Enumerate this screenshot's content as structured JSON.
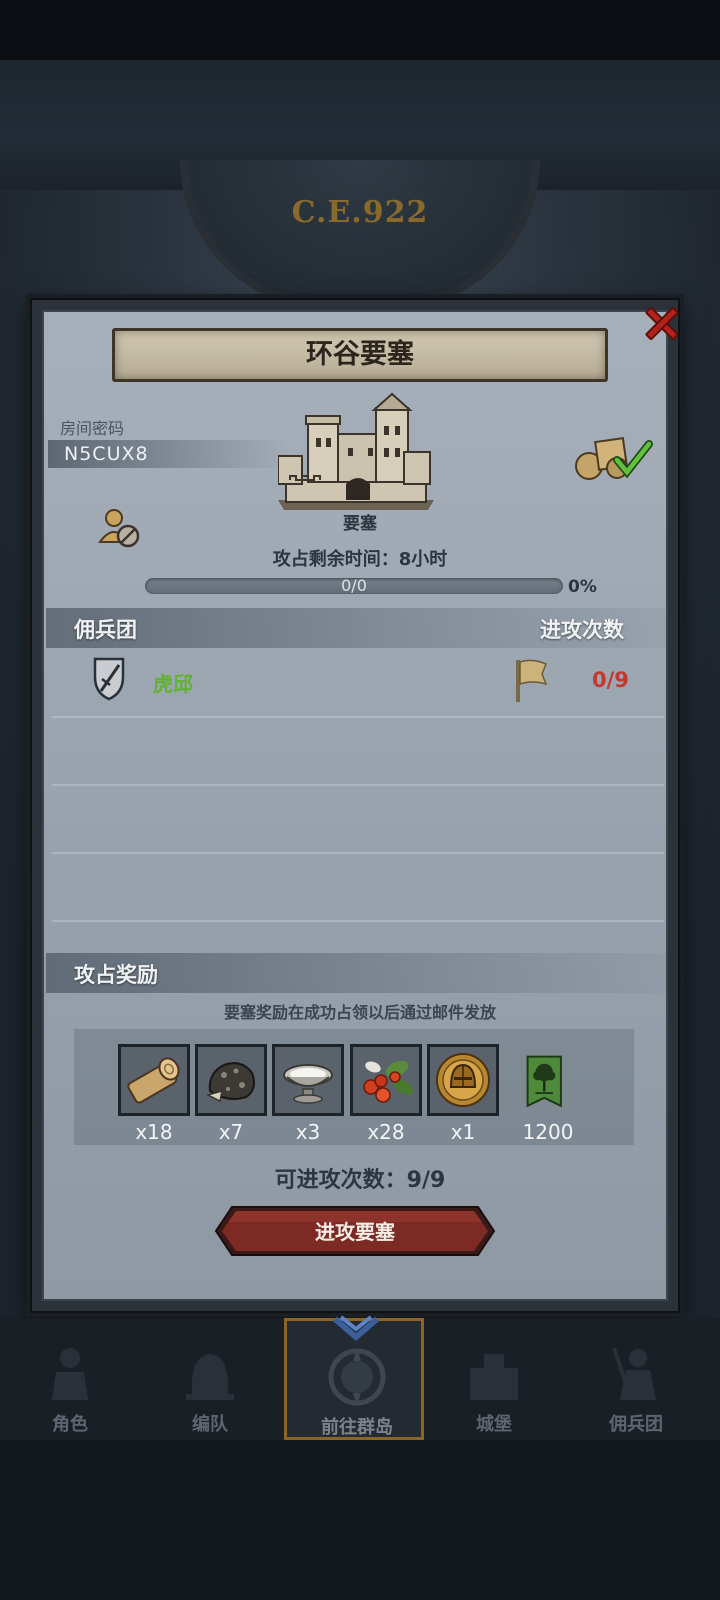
{
  "era": "C.E.922",
  "title": "环谷要塞",
  "room": {
    "label": "房间密码",
    "code": "N5CUX8"
  },
  "fortress": {
    "label": "要塞"
  },
  "capture": {
    "time_text": "攻占剩余时间：8小时",
    "progress_text": "0/0",
    "progress_pct_text": "0%",
    "progress_fraction": 0
  },
  "mercenary": {
    "header_left": "佣兵团",
    "header_right": "进攻次数",
    "rows": [
      {
        "name": "虎邱",
        "count": "0/9"
      }
    ]
  },
  "rewards": {
    "header": "攻占奖励",
    "note": "要塞奖励在成功占领以后通过邮件发放",
    "items": [
      {
        "icon": "log-icon",
        "qty": "x18"
      },
      {
        "icon": "ore-icon",
        "qty": "x7"
      },
      {
        "icon": "bowl-icon",
        "qty": "x3"
      },
      {
        "icon": "berries-icon",
        "qty": "x28"
      },
      {
        "icon": "helmet-medal-icon",
        "qty": "x1"
      },
      {
        "icon": "tree-banner-icon",
        "qty": "1200"
      }
    ]
  },
  "attacks_text": "可进攻次数：9/9",
  "attack_button": "进攻要塞",
  "nav": [
    {
      "label": "角色",
      "icon": "knight-icon"
    },
    {
      "label": "编队",
      "icon": "helmet-icon"
    },
    {
      "label": "前往群岛",
      "icon": "compass-icon"
    },
    {
      "label": "城堡",
      "icon": "castle-icon"
    },
    {
      "label": "佣兵团",
      "icon": "soldier-icon"
    }
  ],
  "colors": {
    "accent_red": "#c03a2f",
    "name_green": "#5fb232",
    "nav_active_border": "#8d6424"
  }
}
